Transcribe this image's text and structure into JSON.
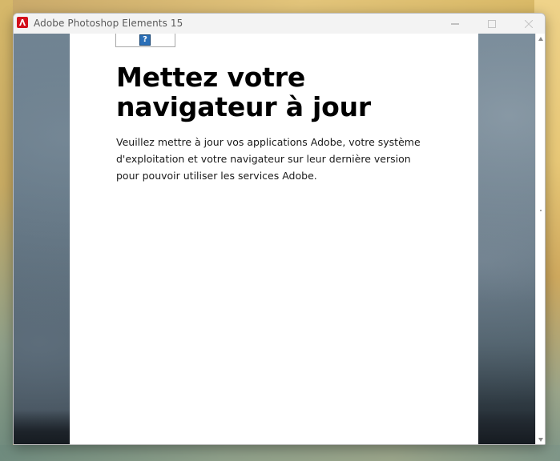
{
  "window": {
    "title": "Adobe Photoshop Elements 15",
    "minimize_label": "–",
    "maximize_label": "□",
    "close_label": "✕"
  },
  "panel": {
    "help_icon_label": "?",
    "heading": "Mettez votre navigateur à jour",
    "body": "Veuillez mettre à jour vos applications Adobe, votre système d'exploitation et votre navigateur sur leur dernière version pour pouvoir utiliser les services Adobe."
  },
  "icons": {
    "app": "adobe-logo-icon",
    "help": "help-icon",
    "minimize": "minimize-icon",
    "maximize": "maximize-icon",
    "close": "close-icon"
  },
  "colors": {
    "adobe_red": "#d3101c",
    "help_blue": "#2a6fb8",
    "titlebar_bg": "#f3f3f3"
  }
}
